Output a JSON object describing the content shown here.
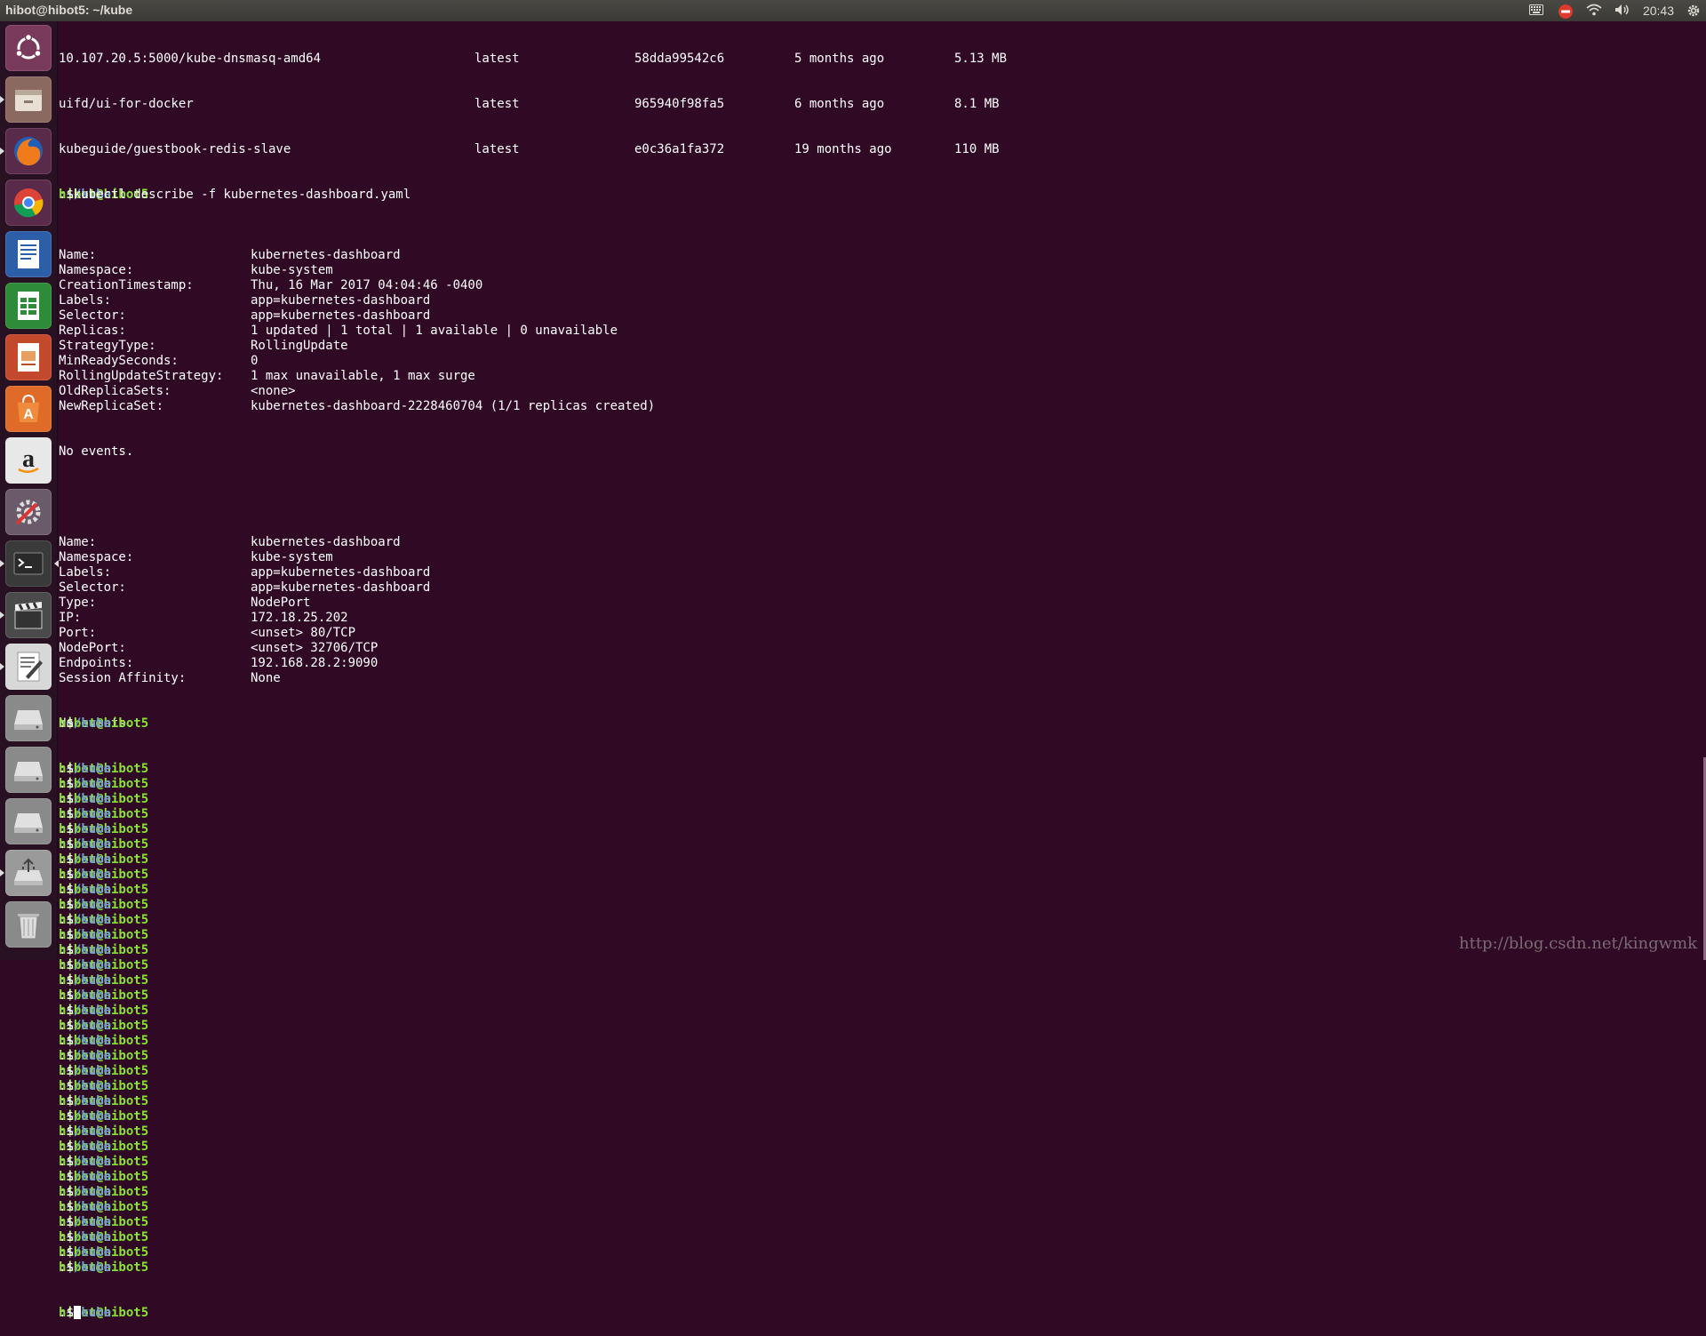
{
  "window": {
    "title": "hibot@hibot5: ~/kube"
  },
  "tray": {
    "clock": "20:43",
    "icons": [
      "keyboard-icon",
      "no-entry-icon",
      "wifi-icon",
      "volume-icon",
      "gear-icon"
    ]
  },
  "launcher": {
    "items": [
      "ubuntu-dash",
      "files",
      "firefox",
      "chrome",
      "writer",
      "calc",
      "impress",
      "software-center",
      "amazon",
      "system-settings",
      "terminal",
      "video-editor",
      "text-editor",
      "drive-1",
      "drive-2",
      "drive-3",
      "usb-drive",
      "trash"
    ]
  },
  "prompt": {
    "user": "hibot@hibot5",
    "path": "~/kube",
    "symbol": "$"
  },
  "images": [
    {
      "repo": "10.107.20.5:5000/kube-dnsmasq-amd64",
      "tag": "latest",
      "id": "58dda99542c6",
      "created": "5 months ago",
      "size": "5.13 MB"
    },
    {
      "repo": "uifd/ui-for-docker",
      "tag": "latest",
      "id": "965940f98fa5",
      "created": "6 months ago",
      "size": "8.1 MB"
    },
    {
      "repo": "kubeguide/guestbook-redis-slave",
      "tag": "latest",
      "id": "e0c36a1fa372",
      "created": "19 months ago",
      "size": "110 MB"
    }
  ],
  "command": "kubectl describe -f kubernetes-dashboard.yaml",
  "deployment": [
    {
      "k": "Name:",
      "v": "kubernetes-dashboard"
    },
    {
      "k": "Namespace:",
      "v": "kube-system"
    },
    {
      "k": "CreationTimestamp:",
      "v": "Thu, 16 Mar 2017 04:04:46 -0400"
    },
    {
      "k": "Labels:",
      "v": "app=kubernetes-dashboard"
    },
    {
      "k": "Selector:",
      "v": "app=kubernetes-dashboard"
    },
    {
      "k": "Replicas:",
      "v": "1 updated | 1 total | 1 available | 0 unavailable"
    },
    {
      "k": "StrategyType:",
      "v": "RollingUpdate"
    },
    {
      "k": "MinReadySeconds:",
      "v": "0"
    },
    {
      "k": "RollingUpdateStrategy:",
      "v": "1 max unavailable, 1 max surge"
    },
    {
      "k": "OldReplicaSets:",
      "v": "<none>"
    },
    {
      "k": "NewReplicaSet:",
      "v": "kubernetes-dashboard-2228460704 (1/1 replicas created)"
    }
  ],
  "no_events": "No events.",
  "service": [
    {
      "k": "Name:",
      "v": "kubernetes-dashboard"
    },
    {
      "k": "Namespace:",
      "v": "kube-system"
    },
    {
      "k": "Labels:",
      "v": "app=kubernetes-dashboard"
    },
    {
      "k": "Selector:",
      "v": "app=kubernetes-dashboard"
    },
    {
      "k": "Type:",
      "v": "NodePort"
    },
    {
      "k": "IP:",
      "v": "172.18.25.202"
    },
    {
      "k": "Port:",
      "v": "<unset> 80/TCP"
    },
    {
      "k": "NodePort:",
      "v": "<unset> 32706/TCP"
    },
    {
      "k": "Endpoints:",
      "v": "192.168.28.2:9090"
    },
    {
      "k": "Session Affinity:",
      "v": "None"
    }
  ],
  "empty_prompt_lines": 34,
  "watermark": "http://blog.csdn.net/kingwmk"
}
